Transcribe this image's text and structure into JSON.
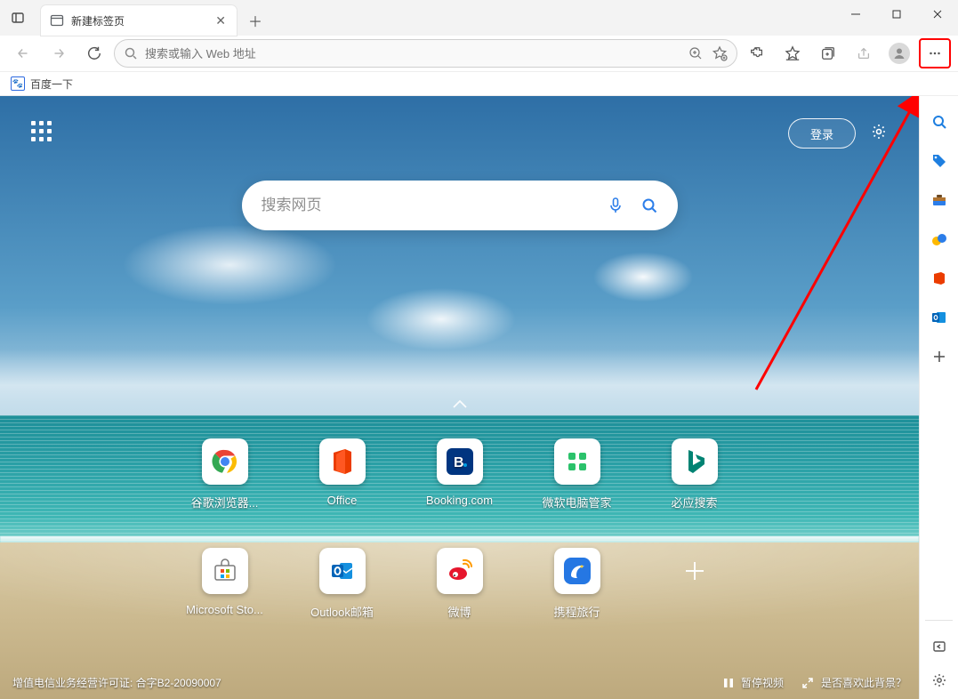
{
  "window": {
    "title": "新建标签页"
  },
  "tab": {
    "title": "新建标签页"
  },
  "omnibox": {
    "placeholder": "搜索或输入 Web 地址"
  },
  "favorites": {
    "baidu": "百度一下"
  },
  "ntp": {
    "signin": "登录",
    "search_placeholder": "搜索网页",
    "pause_video": "暂停视频",
    "like_bg": "是否喜欢此背景？",
    "license": "增值电信业务经营许可证: 合字B2-20090007",
    "tiles": [
      {
        "label": "谷歌浏览器...",
        "name": "chrome"
      },
      {
        "label": "Office",
        "name": "office"
      },
      {
        "label": "Booking.com",
        "name": "booking"
      },
      {
        "label": "微软电脑管家",
        "name": "pcmanager"
      },
      {
        "label": "必应搜索",
        "name": "bing"
      },
      {
        "label": "Microsoft Sto...",
        "name": "msstore"
      },
      {
        "label": "Outlook邮箱",
        "name": "outlook"
      },
      {
        "label": "微博",
        "name": "weibo"
      },
      {
        "label": "携程旅行",
        "name": "ctrip"
      }
    ]
  },
  "colors": {
    "accent": "#2b7de9",
    "highlight": "#ff0000"
  }
}
